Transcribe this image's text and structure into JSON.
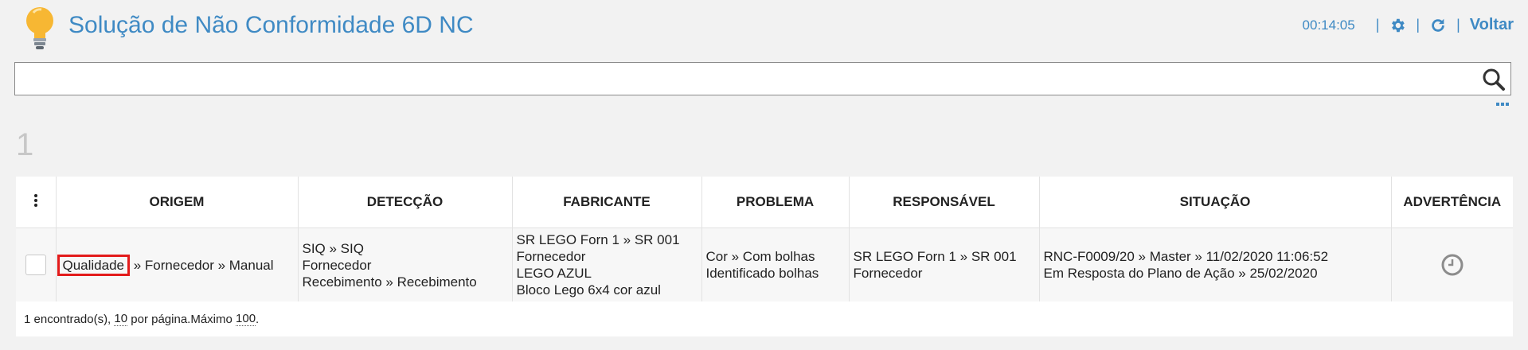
{
  "header": {
    "title": "Solução de Não Conformidade 6D NC",
    "timer": "00:14:05",
    "back_label": "Voltar",
    "accent": "#3f8ac4"
  },
  "search": {
    "value": "",
    "placeholder": ""
  },
  "summary": {
    "count": "1"
  },
  "table": {
    "columns": [
      "ORIGEM",
      "DETECÇÃO",
      "FABRICANTE",
      "PROBLEMA",
      "RESPONSÁVEL",
      "SITUAÇÃO",
      "ADVERTÊNCIA"
    ],
    "row": {
      "origem": {
        "highlighted": "Qualidade",
        "rest": "» Fornecedor » Manual"
      },
      "deteccao": [
        "SIQ » SIQ",
        "Fornecedor",
        "Recebimento » Recebimento"
      ],
      "fabricante": [
        "SR LEGO Forn 1 » SR 001",
        "Fornecedor",
        "LEGO AZUL",
        "Bloco Lego 6x4 cor azul"
      ],
      "problema": [
        "Cor » Com bolhas",
        "Identificado bolhas"
      ],
      "responsavel": [
        "SR LEGO Forn 1 » SR 001",
        "Fornecedor"
      ],
      "situacao": [
        "RNC-F0009/20 » Master » 11/02/2020 11:06:52",
        "Em Resposta do Plano de Ação » 25/02/2020"
      ],
      "advertencia_icon": "clock-icon"
    }
  },
  "footer": {
    "found": "1 encontrado(s),",
    "per_page": "10",
    "per_page_label": "por página.",
    "max_label": "Máximo",
    "max": "100",
    "end": "."
  },
  "colors": {
    "highlight": "#e31b1b"
  }
}
